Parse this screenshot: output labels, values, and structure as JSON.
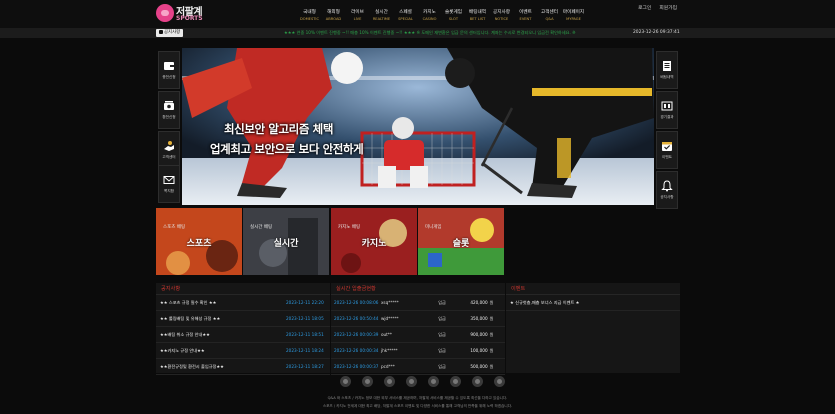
{
  "brand": {
    "name_ko": "저팔계",
    "name_en": "SPORTS"
  },
  "top_links": [
    "로그인",
    "회원가입"
  ],
  "nav": [
    {
      "ko": "국내형",
      "en": "DOMESTIC"
    },
    {
      "ko": "해외형",
      "en": "ABROAD"
    },
    {
      "ko": "라이브",
      "en": "LIVE"
    },
    {
      "ko": "실시간",
      "en": "REALTIME"
    },
    {
      "ko": "스페셜",
      "en": "SPECIAL"
    },
    {
      "ko": "카지노",
      "en": "CASINO"
    },
    {
      "ko": "슬롯게임",
      "en": "SLOT"
    },
    {
      "ko": "배팅내역",
      "en": "BET LIST"
    },
    {
      "ko": "공지사항",
      "en": "NOTICE"
    },
    {
      "ko": "이벤트",
      "en": "EVENT"
    },
    {
      "ko": "고객센터",
      "en": "Q&A"
    },
    {
      "ko": "마이페이지",
      "en": "MYPAGE"
    }
  ],
  "ticker": {
    "badge": "공지사항",
    "text": "★★★ 연중 10% 이벤트 진행중 ~!! 매충 10% 이벤트 진행중 ~!! ★★★ ※ 도메인 재변환은 입금 문의 센터입니다. 계좌는 수시로 변경되오니 입금전 확인하세요. ※",
    "clock": "2023-12-26 09:37:41"
  },
  "side_left": [
    "충전신청",
    "환전신청",
    "고객센터",
    "쪽지함"
  ],
  "side_right": [
    "배팅내역",
    "경기결과",
    "이벤트",
    "공지사항"
  ],
  "banner": {
    "line1": "최신보안 알고리즘 체택",
    "line2": "업계최고 보안으로 보다 안전하게"
  },
  "tiles": [
    {
      "sub": "스포츠 배팅",
      "main": "스포츠",
      "color": "#c4471c"
    },
    {
      "sub": "실시간 배팅",
      "main": "실시간",
      "color": "#3d3f45"
    },
    {
      "sub": "카지노 배팅",
      "main": "카지노",
      "color": "#9a1f1f"
    },
    {
      "sub": "미니게임",
      "main": "슬롯",
      "color": "#b23a2c"
    }
  ],
  "notice": {
    "title": "공지사항",
    "rows": [
      {
        "title": "★★ 스포츠 규정 필수 확인 ★★",
        "date": "2023-12-11 22:20"
      },
      {
        "title": "★★ 롤링배팅 및 유해성 규정 ★★",
        "date": "2023-12-11 18:05"
      },
      {
        "title": "★★배팅 취소 규정 안내★★",
        "date": "2023-12-11 18:51"
      },
      {
        "title": "★★카지노 규정 안내★★",
        "date": "2023-12-11 18:24"
      },
      {
        "title": "★★환전규정및 환전시 출입규정★★",
        "date": "2023-12-11 18:27"
      }
    ]
  },
  "deposit": {
    "title": "실시간 입출금현황",
    "rows": [
      {
        "date": "2023-12-26 00:08:06",
        "user": "xsq*****",
        "type": "입금",
        "amount": "420,000",
        "unit": "원"
      },
      {
        "date": "2023-12-26 00:50:44",
        "user": "wjd*****",
        "type": "입금",
        "amount": "350,000",
        "unit": "원"
      },
      {
        "date": "2023-12-26 00:00:39",
        "user": "out**",
        "type": "입금",
        "amount": "900,000",
        "unit": "원"
      },
      {
        "date": "2023-12-26 00:00:34",
        "user": "jhk*****",
        "type": "입금",
        "amount": "100,000",
        "unit": "원"
      },
      {
        "date": "2023-12-26 00:00:37",
        "user": "pcd***",
        "type": "입금",
        "amount": "500,000",
        "unit": "원"
      }
    ]
  },
  "event": {
    "title": "이벤트",
    "rows": [
      {
        "title": "★ 신규첫충,매충 보너스 지급 이벤트 ★"
      }
    ]
  },
  "footer": {
    "line1": "Q&A 와 스포츠 / 카지노 정보 대한 외부 서비스를 제공하며, 저팔계 서비스를 제공할 수 있도록 최선을 다하고 있습니다.",
    "line2": "스포츠 / 카지노 전세계 대한 최고 배당, 저팔계 스포츠 이벤트 및 다양한 서비스를 통해 고객님의 만족을 위해 노력 하겠습니다."
  },
  "colors": {
    "accent_red": "#c9362f",
    "date_blue": "#2d9be2",
    "ticker_green": "#2ba34a",
    "gold": "#c8a24a"
  }
}
